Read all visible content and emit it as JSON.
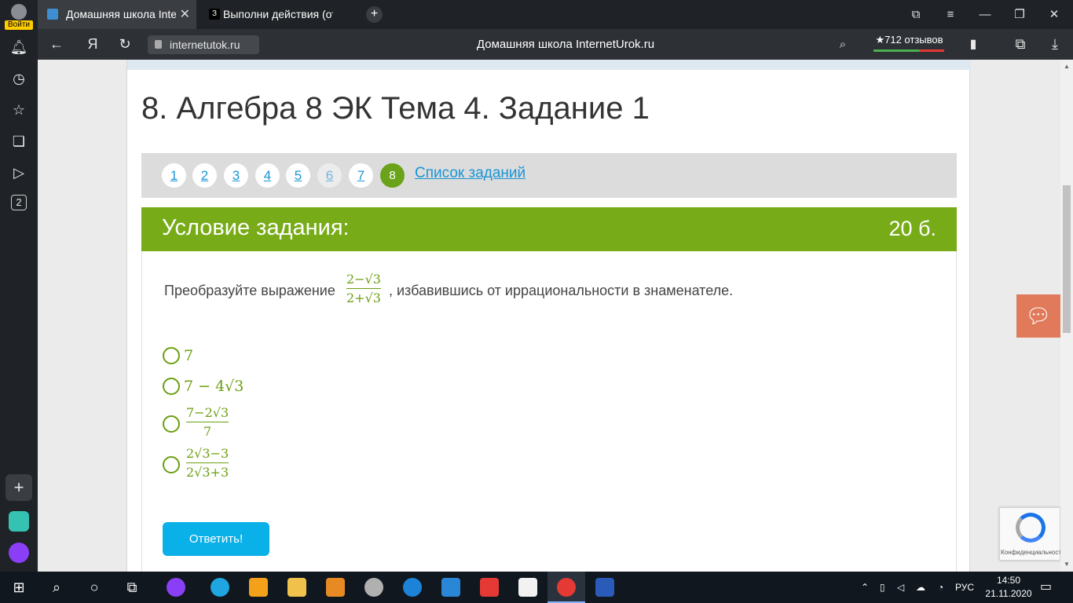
{
  "browser": {
    "profile_label": "Войти",
    "tabs": [
      {
        "title": "Домашняя школа InternetUrok.ru"
      },
      {
        "title": "Выполни действия (ответ"
      }
    ],
    "address": "internetutok.ru",
    "page_title": "Домашняя школа InternetUrok.ru",
    "reviews": "★712 отзывов"
  },
  "sidebar": {
    "badge": "2"
  },
  "page": {
    "heading": "8. Алгебра 8 ЭК Тема 4. Задание 1",
    "pager": {
      "pages": [
        "1",
        "2",
        "3",
        "4",
        "5",
        "6",
        "7",
        "8"
      ],
      "current": "8",
      "list_link": "Список заданий"
    },
    "task": {
      "title": "Условие задания:",
      "score": "20 б.",
      "question_before": "Преобразуйте выражение",
      "question_after": ", избавившись от иррациональности в знаменателе.",
      "expression": {
        "num": "2−√3",
        "den": "2+√3"
      },
      "options": [
        {
          "text": "7"
        },
        {
          "text": "7 − 4√3"
        },
        {
          "num": "7−2√3",
          "den": "7"
        },
        {
          "num": "2√3−3",
          "den": "2√3+3"
        }
      ],
      "answer_button": "Ответить!"
    },
    "recaptcha_caption": "Конфиденциальность"
  },
  "taskbar": {
    "language": "РУС",
    "time": "14:50",
    "date": "21.11.2020"
  }
}
